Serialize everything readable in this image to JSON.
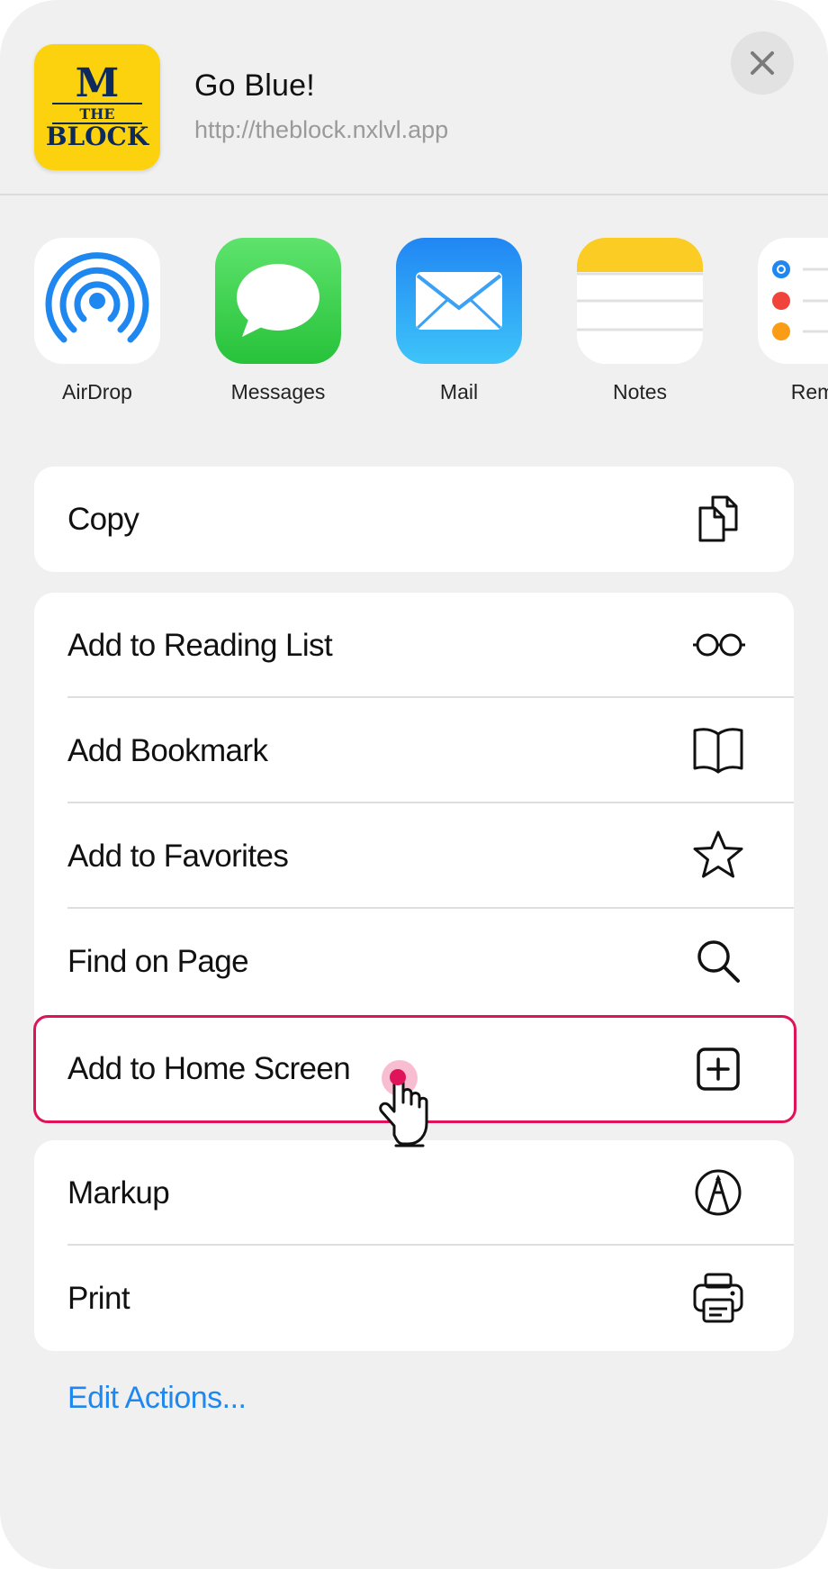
{
  "header": {
    "title": "Go Blue!",
    "url": "http://theblock.nxlvl.app",
    "logo_text": [
      "M",
      "THE",
      "BLOCK"
    ],
    "logo_color": "#fcd20f"
  },
  "share_apps": [
    {
      "label": "AirDrop",
      "icon": "airdrop-icon"
    },
    {
      "label": "Messages",
      "icon": "messages-icon"
    },
    {
      "label": "Mail",
      "icon": "mail-icon"
    },
    {
      "label": "Notes",
      "icon": "notes-icon"
    },
    {
      "label": "Remin",
      "icon": "reminders-icon"
    }
  ],
  "actions": {
    "copy": {
      "label": "Copy",
      "icon": "copy-icon"
    },
    "reading_list": {
      "label": "Add to Reading List",
      "icon": "glasses-icon"
    },
    "bookmark": {
      "label": "Add Bookmark",
      "icon": "book-icon"
    },
    "favorites": {
      "label": "Add to Favorites",
      "icon": "star-icon"
    },
    "find": {
      "label": "Find on Page",
      "icon": "search-icon"
    },
    "home_screen": {
      "label": "Add to Home Screen",
      "icon": "plus-square-icon"
    },
    "markup": {
      "label": "Markup",
      "icon": "markup-icon"
    },
    "print": {
      "label": "Print",
      "icon": "printer-icon"
    }
  },
  "edit_actions_label": "Edit Actions...",
  "colors": {
    "highlight": "#e0125a",
    "link": "#1e88f0",
    "background": "#f0f0f0"
  }
}
